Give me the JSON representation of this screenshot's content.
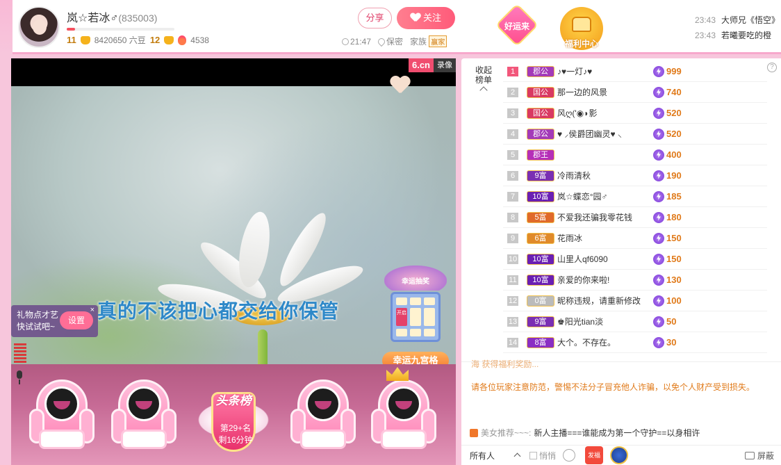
{
  "anchor": {
    "name": "岚☆若冰♂",
    "room_id": "(835003)",
    "level": "11",
    "beans": "8420650 六豆",
    "fortune_level": "12",
    "hot": "4538"
  },
  "header": {
    "share_label": "分享",
    "follow_label": "关注",
    "time": "21:47",
    "location": "保密",
    "family_label": "家族",
    "family_tag": "赢家",
    "lucky_label": "好运来",
    "welfare_label": "福利中心",
    "level_progress_pct": 8
  },
  "chatlog": [
    {
      "time": "23:43",
      "text": "大师兄《悟空》"
    },
    {
      "time": "23:43",
      "text": "若曦要吃的橙"
    }
  ],
  "video": {
    "logo_main": "6.cn",
    "logo_sub": "录像",
    "subtitle": "真的不该把心都交给你保管",
    "nine_palace_title": "幸运抽奖",
    "nine_palace_active": "开启",
    "nine_palace_label": "幸运九宫格",
    "gift_tip_line1": "礼物点才艺",
    "gift_tip_line2": "快试试吧~",
    "gift_tip_button": "设置",
    "gift_tip_close": "×"
  },
  "headline": {
    "title": "头条榜",
    "rank": "第29+名",
    "remain": "剩16分钟"
  },
  "rank_panel": {
    "collapse_label": "收起榜单",
    "help": "?",
    "rows": [
      {
        "no": "1",
        "badge": "郡公",
        "badge_color": "#a33ab8",
        "name": "♪♥一灯♪♥",
        "score": "999"
      },
      {
        "no": "2",
        "badge": "国公",
        "badge_color": "#d93a62",
        "name": "那一边的风景",
        "score": "740"
      },
      {
        "no": "3",
        "badge": "国公",
        "badge_color": "#d93a62",
        "name": "风ღ('◉◗影",
        "score": "520"
      },
      {
        "no": "4",
        "badge": "郡公",
        "badge_color": "#a33ab8",
        "name": "♥ ⸝侯爵团幽灵♥ ⸜",
        "score": "520"
      },
      {
        "no": "5",
        "badge": "郡王",
        "badge_color": "#b52fb8",
        "name": "",
        "score": "400"
      },
      {
        "no": "6",
        "badge": "9富",
        "badge_color": "#7a2fb3",
        "name": "冷雨清秋",
        "score": "190"
      },
      {
        "no": "7",
        "badge": "10富",
        "badge_color": "#6a1fb3",
        "name": "岚☆蝶恋°园♂",
        "score": "185"
      },
      {
        "no": "8",
        "badge": "5富",
        "badge_color": "#e06a2a",
        "name": "不爱我还骗我零花钱",
        "score": "180"
      },
      {
        "no": "9",
        "badge": "6富",
        "badge_color": "#e08a2a",
        "name": "花雨冰",
        "score": "150"
      },
      {
        "no": "10",
        "badge": "10富",
        "badge_color": "#6a1fb3",
        "name": "山里人qf6090",
        "score": "150"
      },
      {
        "no": "11",
        "badge": "10富",
        "badge_color": "#6a1fb3",
        "name": "亲爱的你来啦!",
        "score": "130"
      },
      {
        "no": "12",
        "badge": "0富",
        "badge_color": "#bbbbbb",
        "name": "昵称违规，请重新修改",
        "score": "100"
      },
      {
        "no": "13",
        "badge": "9富",
        "badge_color": "#7a2fb3",
        "name": "♚阳光tian淡",
        "score": "50"
      },
      {
        "no": "14",
        "badge": "8富",
        "badge_color": "#8a2fc3",
        "name": "大个。不存在。",
        "score": "30"
      }
    ]
  },
  "chat": {
    "cut_line": "海 获得福利奖励...",
    "notice": "请各位玩家注意防范，警惕不法分子冒充他人诈骗，以免个人财产受到损失。",
    "rec_tag": "美女推荐~~~:",
    "rec_text": "新人主播===谁能成为第一个守护==以身相许"
  },
  "bottombar": {
    "target": "所有人",
    "whisper": "悄悄",
    "gift_label": "发福利",
    "shield": "屏蔽"
  }
}
